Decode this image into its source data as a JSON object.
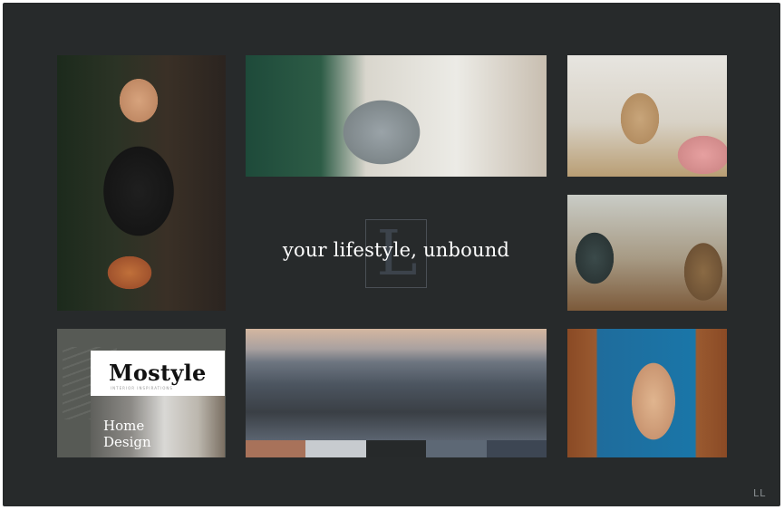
{
  "tagline": "your lifestyle, unbound",
  "monogram": "L",
  "corner_logo": "LL",
  "mockup": {
    "title": "Mostyle",
    "subtitle": "INTERIOR INSPIRATIONS",
    "overlay_text": "Home Design"
  },
  "palette": [
    "#a8725a",
    "#c7cbcf",
    "#26292a",
    "#5d6875",
    "#3d4653"
  ],
  "colors": {
    "background": "#272a2b",
    "tagline_text": "#ffffff"
  },
  "photos": [
    "man-holding-plants",
    "woman-relaxing-in-chair",
    "friends-laughing-on-floor",
    "friends-dining",
    "city-skyline-aerial",
    "woman-sunbathing-poolside"
  ]
}
